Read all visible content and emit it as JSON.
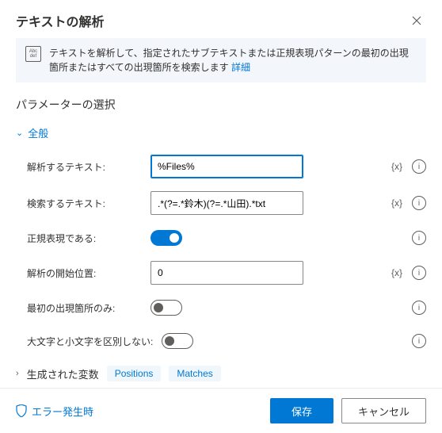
{
  "header": {
    "title": "テキストの解析"
  },
  "banner": {
    "text": "テキストを解析して、指定されたサブテキストまたは正規表現パターンの最初の出現箇所またはすべての出現箇所を検索します ",
    "link": "詳細",
    "icon_top": "Abc",
    "icon_bottom": "def"
  },
  "section_title": "パラメーターの選択",
  "group": {
    "general": "全般",
    "generated": "生成された変数"
  },
  "fields": {
    "parse_text": {
      "label": "解析するテキスト:",
      "value": "%Files%",
      "var": "{x}"
    },
    "search_text": {
      "label": "検索するテキスト:",
      "value": ".*(?=.*鈴木)(?=.*山田).*txt",
      "var": "{x}"
    },
    "is_regex": {
      "label": "正規表現である:"
    },
    "start_pos": {
      "label": "解析の開始位置:",
      "value": "0",
      "var": "{x}"
    },
    "first_only": {
      "label": "最初の出現箇所のみ:"
    },
    "case_sensitive": {
      "label": "大文字と小文字を区別しない:"
    }
  },
  "chips": {
    "positions": "Positions",
    "matches": "Matches"
  },
  "footer": {
    "on_error": "エラー発生時",
    "save": "保存",
    "cancel": "キャンセル"
  }
}
